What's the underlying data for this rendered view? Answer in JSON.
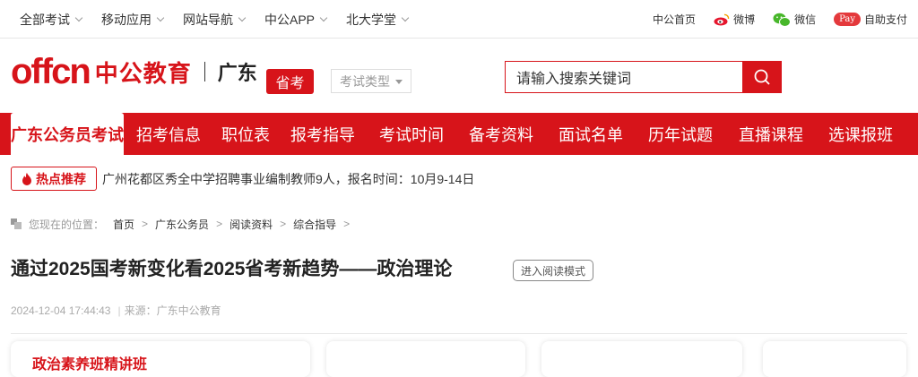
{
  "topbar": {
    "left": [
      "全部考试",
      "移动应用",
      "网站导航",
      "中公APP",
      "北大学堂"
    ],
    "right": {
      "home": "中公首页",
      "weibo": "微博",
      "wechat": "微信",
      "pay_badge": "Pay",
      "pay": "自助支付"
    }
  },
  "header": {
    "logo_latin": "offcn",
    "logo_cn": "中公教育",
    "region": "广东",
    "province_badge": "省考",
    "exam_type": "考试类型",
    "search_placeholder": "请输入搜索关键词"
  },
  "nav": [
    "广东公务员考试",
    "招考信息",
    "职位表",
    "报考指导",
    "考试时间",
    "备考资料",
    "面试名单",
    "历年试题",
    "直播课程",
    "选课报班"
  ],
  "hot": {
    "label": "热点推荐",
    "text": "广州花都区秀全中学招聘事业编制教师9人，报名时间：10月9-14日"
  },
  "breadcrumb": {
    "prefix": "您现在的位置：",
    "items": [
      "首页",
      "广东公务员",
      "阅读资料",
      "综合指导"
    ]
  },
  "article": {
    "title": "通过2025国考新变化看2025省考新趋势——政治理论",
    "read_mode": "进入阅读模式",
    "date": "2024-12-04 17:44:43",
    "source": "来源：广东中公教育"
  },
  "cards": {
    "first_title": "政治素养班精讲班"
  },
  "colors": {
    "brand_red": "#d7141a"
  }
}
